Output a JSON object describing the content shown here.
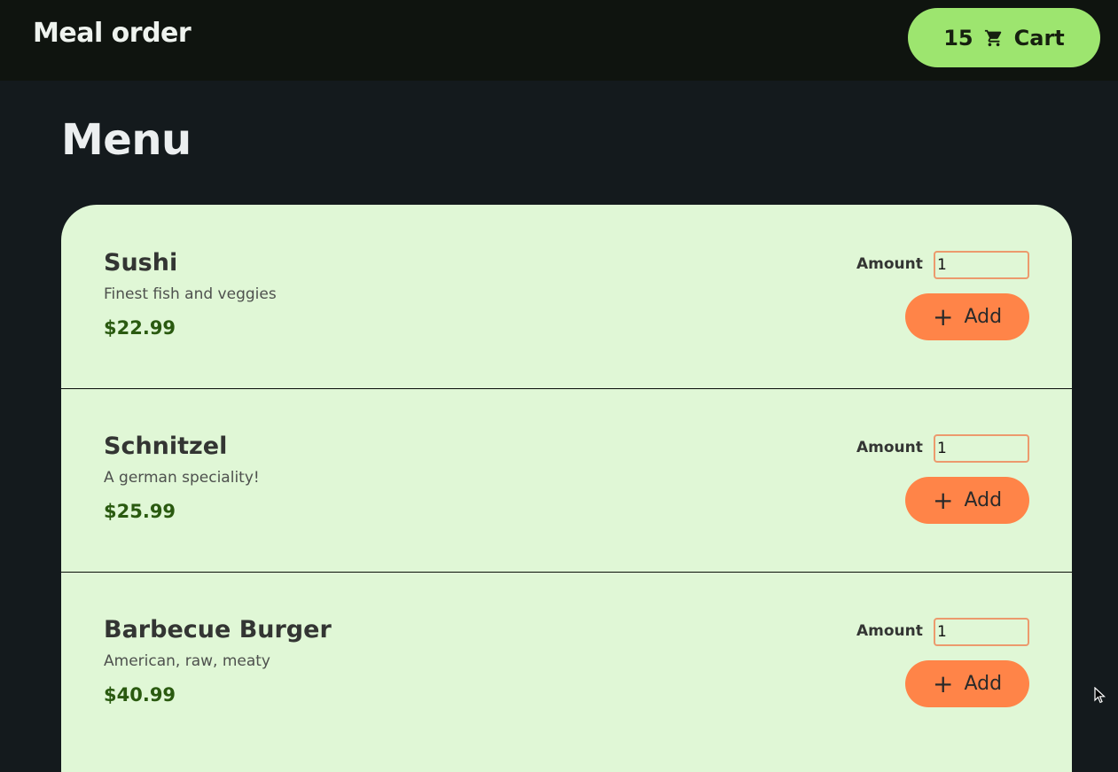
{
  "header": {
    "title": "Meal order",
    "cart": {
      "count": "15",
      "label": "Cart",
      "icon": "cart-icon"
    }
  },
  "main": {
    "title": "Menu",
    "meals": [
      {
        "name": "Sushi",
        "description": "Finest fish and veggies",
        "price": "$22.99",
        "amount_label": "Amount",
        "amount_value": "1",
        "add_label": "Add",
        "add_icon": "plus-icon"
      },
      {
        "name": "Schnitzel",
        "description": "A german speciality!",
        "price": "$25.99",
        "amount_label": "Amount",
        "amount_value": "1",
        "add_label": "Add",
        "add_icon": "plus-icon"
      },
      {
        "name": "Barbecue Burger",
        "description": "American, raw, meaty",
        "price": "$40.99",
        "amount_label": "Amount",
        "amount_value": "1",
        "add_label": "Add",
        "add_icon": "plus-icon"
      }
    ]
  },
  "colors": {
    "header_bg": "#0f140f",
    "page_bg": "#141a1d",
    "card_bg": "#e0f7d6",
    "cart_button": "#9de56f",
    "add_button": "#ff8448",
    "price": "#2a5a10"
  }
}
